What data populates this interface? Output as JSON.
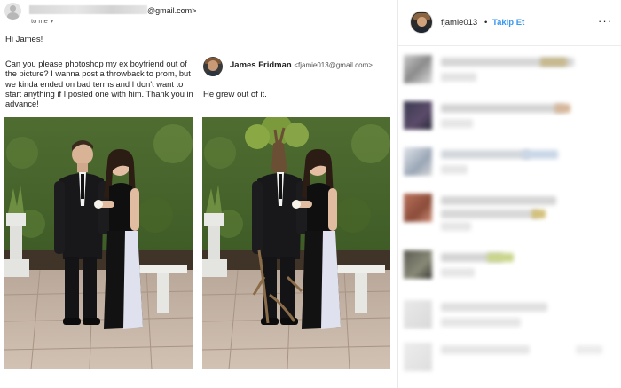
{
  "email": {
    "sender_suffix": "@gmail.com>",
    "to_me": "to me",
    "greeting": "Hi James!",
    "message": "Can you please photoshop my ex boyfriend out of the picture? I wanna post a throwback to prom, but we kinda ended on bad terms and I don't want to start anything if I posted one with him. Thank you in advance!",
    "reply": {
      "name": "James Fridman",
      "address": "<fjamie013@gmail.com>",
      "text": "He grew out of it."
    },
    "photos": {
      "left_alt": "Prom couple original",
      "right_alt": "Prom couple edited"
    }
  },
  "instagram": {
    "username": "fjamie013",
    "separator": "•",
    "follow_label": "Takip Et",
    "more_label": "···",
    "accent": "#3897f0"
  },
  "colors": {
    "hedge": "#5f7a3a",
    "paving": "#c9b7a8"
  }
}
